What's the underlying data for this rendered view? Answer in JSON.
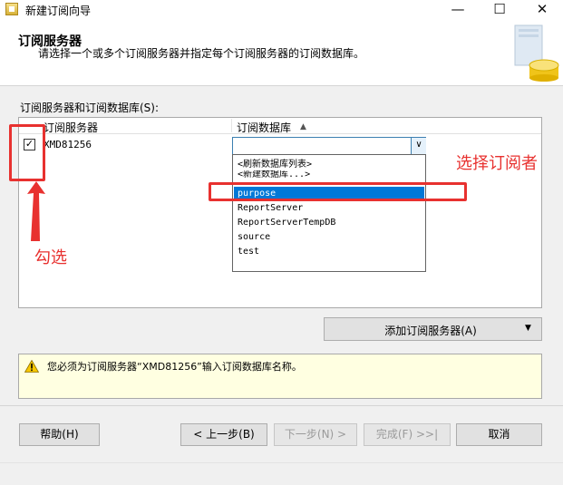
{
  "window": {
    "title": "新建订阅向导",
    "controls": {
      "minimize": "—",
      "maximize": "☐",
      "close": "✕"
    }
  },
  "header": {
    "title": "订阅服务器",
    "subtitle": "请选择一个或多个订阅服务器并指定每个订阅服务器的订阅数据库。"
  },
  "section_label": "订阅服务器和订阅数据库(S):",
  "grid": {
    "columns": [
      "订阅服务器",
      "订阅数据库"
    ],
    "sort_indicator": "▲",
    "rows": [
      {
        "checked": true,
        "check_glyph": "✓",
        "server": "XMD81256",
        "database": ""
      }
    ]
  },
  "dropdown": {
    "arrow": "∨",
    "options": [
      "<刷新数据库列表>",
      "<新建数据库...>",
      "purpose",
      "ReportServer",
      "ReportServerTempDB",
      "source",
      "test"
    ],
    "selected_index": 2
  },
  "annotations": {
    "select_subscriber": "选择订阅者",
    "check": "勾选",
    "color": "#e8312f"
  },
  "add_button": {
    "label": "添加订阅服务器(A)",
    "arrow": "▼"
  },
  "message": {
    "icon": "warning-icon",
    "text": "您必须为订阅服务器“XMD81256”输入订阅数据库名称。"
  },
  "buttons": {
    "help": "帮助(H)",
    "prev": "< 上一步(B)",
    "next": "下一步(N) >",
    "finish": "完成(F) >>|",
    "cancel": "取消"
  },
  "colors": {
    "selection": "#0078d7",
    "message_bg": "#ffffe1",
    "accent": "#3c7fb1"
  }
}
